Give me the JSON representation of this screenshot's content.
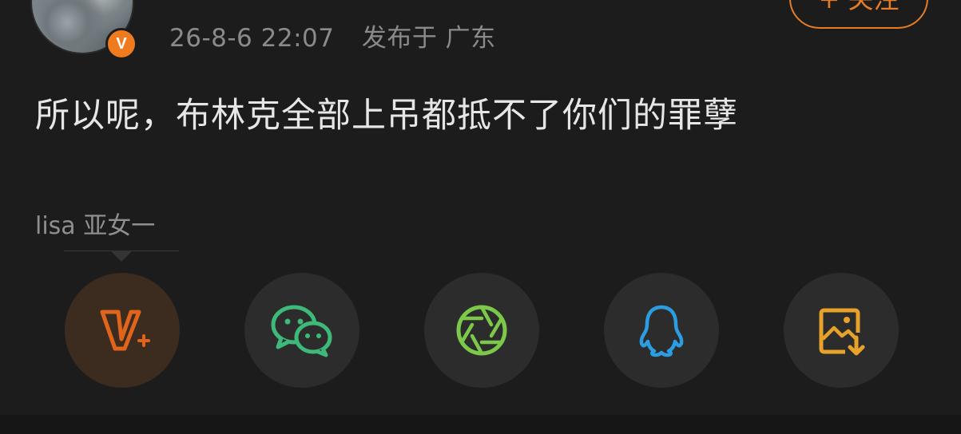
{
  "post": {
    "time": "26-8-6 22:07",
    "location": "发布于 广东",
    "content": "所以呢，布林克全部上吊都抵不了你们的罪孽",
    "source": "lisa 亚女一",
    "follow_label": "+ 关注",
    "verified_badge": "V"
  },
  "share": {
    "items": [
      {
        "name": "vplus",
        "icon": "v-plus-icon",
        "color": "#e0641c"
      },
      {
        "name": "wechat",
        "icon": "wechat-icon",
        "color": "#3fb97a"
      },
      {
        "name": "moments",
        "icon": "aperture-icon",
        "color": "#7cc94a"
      },
      {
        "name": "qq",
        "icon": "qq-penguin-icon",
        "color": "#2b9de0"
      },
      {
        "name": "save-image",
        "icon": "save-image-icon",
        "color": "#e8a22a"
      }
    ]
  },
  "colors": {
    "background": "#1c1c1c",
    "accent": "#e57d24",
    "text": "#e6e6e6",
    "muted": "#8a8a8a"
  }
}
